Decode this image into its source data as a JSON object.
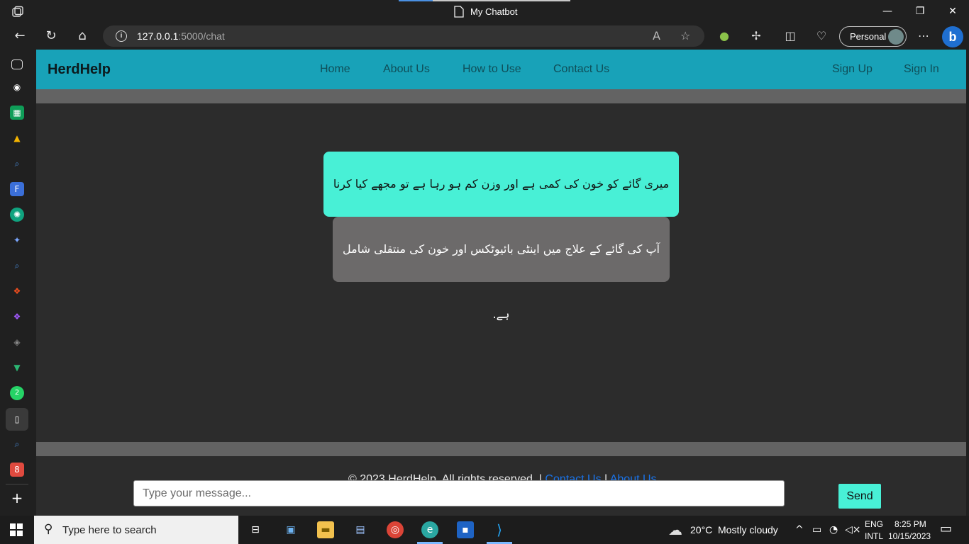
{
  "browser": {
    "window_title": "My Chatbot",
    "url_host": "127.0.0.1",
    "url_rest": ":5000/chat",
    "profile_label": "Personal"
  },
  "site": {
    "brand": "HerdHelp",
    "nav": [
      "Home",
      "About Us",
      "How to Use",
      "Contact Us"
    ],
    "auth": [
      "Sign Up",
      "Sign In"
    ]
  },
  "chat": {
    "messages": [
      {
        "role": "user",
        "text": "میری گائے کو خون کی کمی ہے اور وزن کم ہو رہا ہے تو مجھے کیا کرنا چاہئے"
      },
      {
        "role": "bot",
        "text": "آپ کی گائے کے علاج میں اینٹی بائیوٹکس اور خون کی منتقلی شامل ہے."
      }
    ],
    "input_placeholder": "Type your message...",
    "send_label": "Send"
  },
  "footer": {
    "copyright": "© 2023 HerdHelp. All rights reserved. |",
    "contact_link": "Contact Us",
    "separator": "|",
    "about_link": "About Us"
  },
  "taskbar": {
    "search_placeholder": "Type here to search",
    "weather_temp": "20°C",
    "weather_desc": "Mostly cloudy",
    "lang_top": "ENG",
    "lang_bottom": "INTL",
    "time": "8:25 PM",
    "date": "10/15/2023"
  },
  "colors": {
    "header": "#18a2b8",
    "user_bubble": "#48f0d6",
    "bot_bubble": "#6c6a6a",
    "page_bg": "#2c2c2c"
  }
}
